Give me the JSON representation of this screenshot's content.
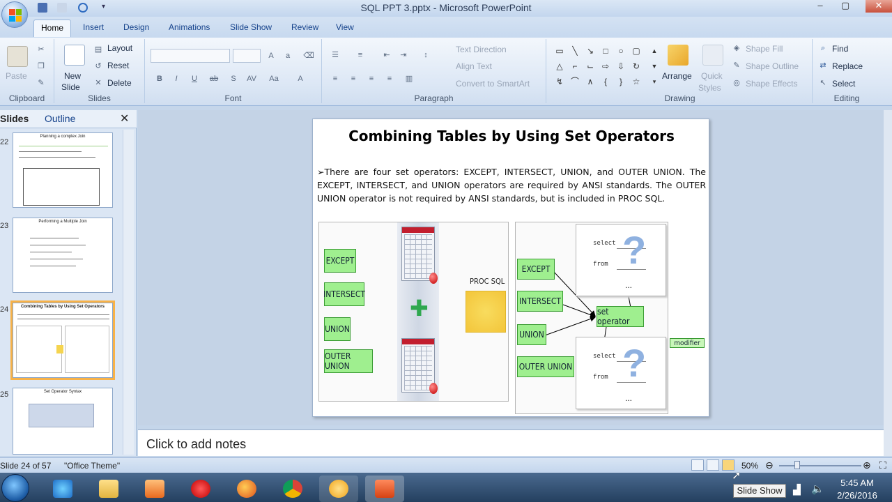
{
  "window": {
    "title": "SQL PPT 3.pptx - Microsoft PowerPoint",
    "controls": {
      "minimize": "‒",
      "maximize": "▢",
      "close": "✕"
    }
  },
  "tabs": [
    "Home",
    "Insert",
    "Design",
    "Animations",
    "Slide Show",
    "Review",
    "View"
  ],
  "active_tab": "Home",
  "ribbon": {
    "clipboard": {
      "label": "Clipboard",
      "paste": "Paste"
    },
    "slides": {
      "label": "Slides",
      "new_slide": "New",
      "new_slide2": "Slide",
      "layout": "Layout",
      "reset": "Reset",
      "delete": "Delete"
    },
    "font": {
      "label": "Font"
    },
    "paragraph": {
      "label": "Paragraph",
      "text_direction": "Text Direction",
      "align_text": "Align Text",
      "convert_smartart": "Convert to SmartArt"
    },
    "drawing": {
      "label": "Drawing",
      "arrange": "Arrange",
      "quick_styles": "Quick",
      "quick_styles2": "Styles",
      "shape_fill": "Shape Fill",
      "shape_outline": "Shape Outline",
      "shape_effects": "Shape Effects"
    },
    "editing": {
      "label": "Editing",
      "find": "Find",
      "replace": "Replace",
      "select": "Select"
    }
  },
  "left_panel": {
    "tab_slides": "Slides",
    "tab_outline": "Outline",
    "thumbnails": [
      {
        "num": "22",
        "title": "Planning a complex Join"
      },
      {
        "num": "23",
        "title": "Performing a Multiple Join"
      },
      {
        "num": "24",
        "title": "Combining Tables by Using Set Operators"
      },
      {
        "num": "25",
        "title": "Set Operator Syntax"
      }
    ]
  },
  "slide": {
    "title": "Combining Tables by Using Set Operators",
    "bullet": "➢",
    "body": "There are four set operators: EXCEPT, INTERSECT, UNION, and OUTER UNION. The EXCEPT, INTERSECT, and UNION operators are required by ANSI standards. The OUTER UNION operator is not required by ANSI standards, but is included in PROC SQL.",
    "left_diagram": {
      "operators": [
        "EXCEPT",
        "INTERSECT",
        "UNION",
        "OUTER UNION"
      ],
      "proc_sql": "PROC SQL",
      "plus": "✚"
    },
    "right_diagram": {
      "operators": [
        "EXCEPT",
        "INTERSECT",
        "UNION",
        "OUTER UNION"
      ],
      "set_operator": "set operator",
      "modifier": "modifier",
      "select": "select",
      "from": "from",
      "qmark": "?",
      "dots": "..."
    }
  },
  "notes": {
    "placeholder": "Click to add notes"
  },
  "status": {
    "slide_info": "Slide 24 of 57",
    "theme": "\"Office Theme\"",
    "zoom": "50%"
  },
  "taskbar": {
    "time": "5:45 AM",
    "date": "2/26/2016",
    "tooltip": "Slide Show"
  },
  "colors": {
    "accent_green": "#9fef8f",
    "selection_orange": "#f8b248",
    "ribbon_blue": "#15428b"
  }
}
